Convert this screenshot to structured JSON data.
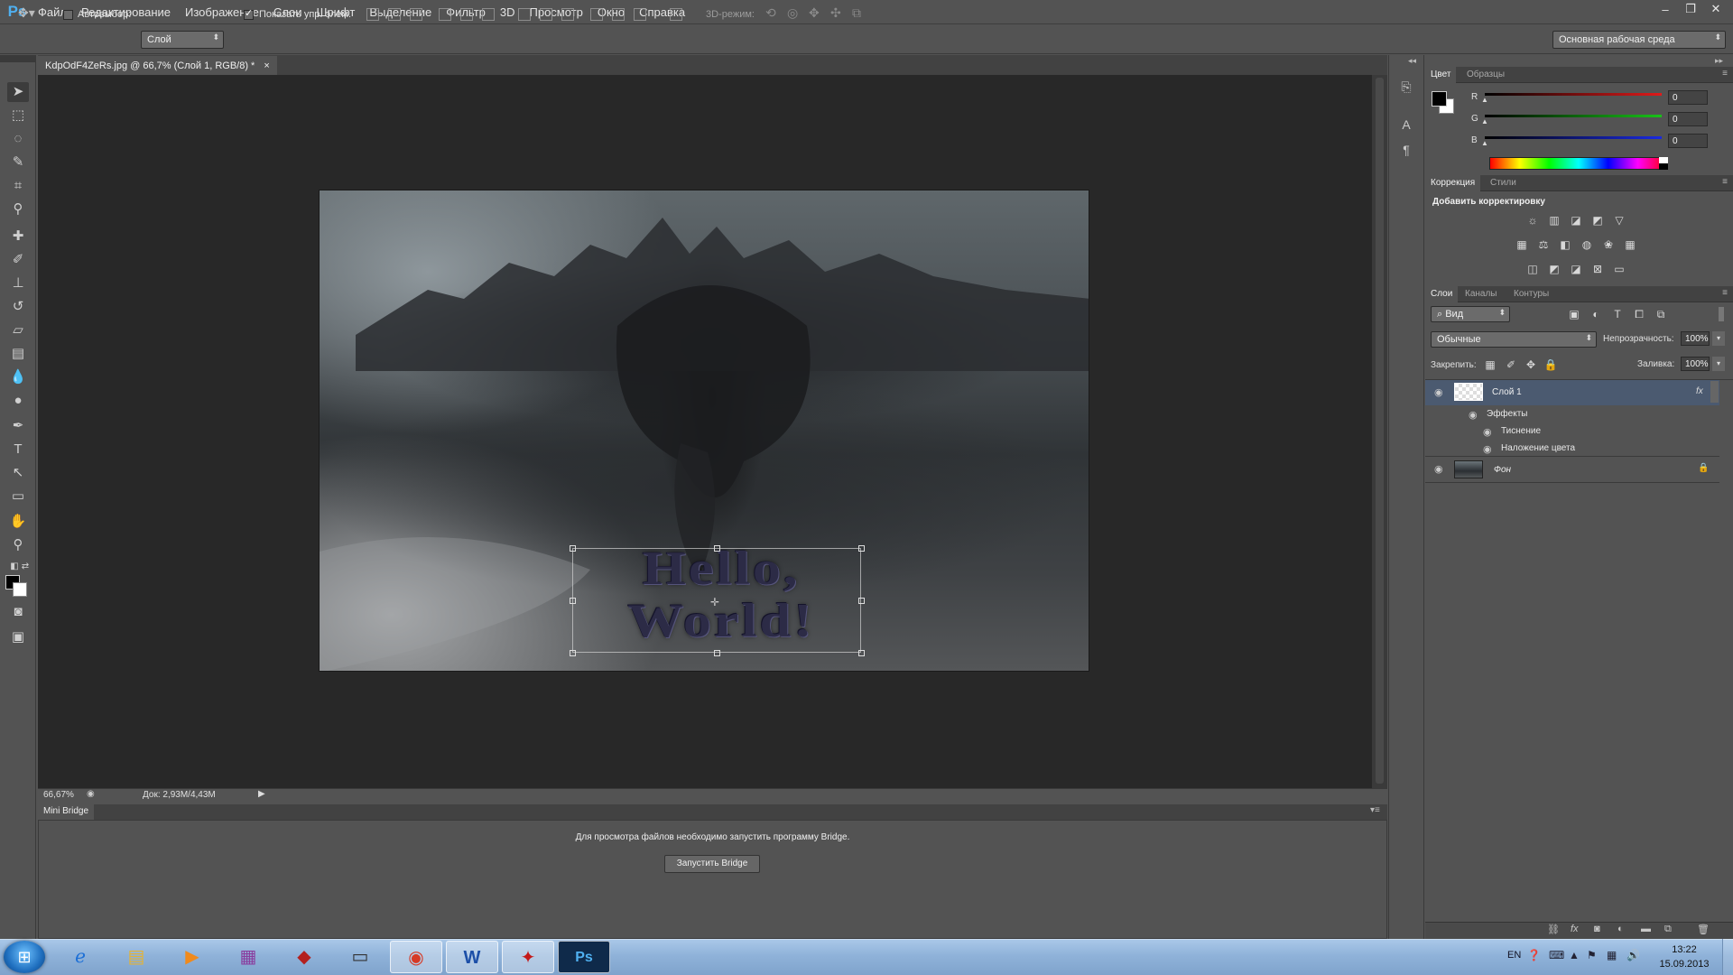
{
  "app": {
    "logo": "Ps"
  },
  "menu": [
    "Файл",
    "Редактирование",
    "Изображение",
    "Слои",
    "Шрифт",
    "Выделение",
    "Фильтр",
    "3D",
    "Просмотр",
    "Окно",
    "Справка"
  ],
  "window_controls": [
    "–",
    "❐",
    "✕"
  ],
  "options": {
    "autoselect_label": "Автовыбор:",
    "autoselect_value": "Слой",
    "show_transform_label": "Показать упр. элем.",
    "mode3d_label": "3D-режим:",
    "workspace": "Основная рабочая среда"
  },
  "document": {
    "tab_title": "KdpOdF4ZeRs.jpg @ 66,7% (Слой 1, RGB/8) *",
    "tab_close": "×",
    "canvas_text_line1": "Hello,",
    "canvas_text_line2": "World!",
    "zoom": "66,67%",
    "doc_size": "Док: 2,93M/4,43M"
  },
  "mini_bridge": {
    "tab": "Mini Bridge",
    "message": "Для просмотра файлов необходимо запустить программу Bridge.",
    "button": "Запустить Bridge"
  },
  "color_panel": {
    "tabs": [
      "Цвет",
      "Образцы"
    ],
    "channels": [
      {
        "label": "R",
        "value": "0",
        "color": "#e01a1a"
      },
      {
        "label": "G",
        "value": "0",
        "color": "#18c218"
      },
      {
        "label": "B",
        "value": "0",
        "color": "#1a2ae0"
      }
    ]
  },
  "adjustments_panel": {
    "tabs": [
      "Коррекция",
      "Стили"
    ],
    "title": "Добавить корректировку"
  },
  "layers_panel": {
    "tabs": [
      "Слои",
      "Каналы",
      "Контуры"
    ],
    "filter": "Вид",
    "blend_mode": "Обычные",
    "opacity_label": "Непрозрачность:",
    "opacity_value": "100%",
    "lock_label": "Закрепить:",
    "fill_label": "Заливка:",
    "fill_value": "100%",
    "layers": [
      {
        "name": "Слой 1",
        "fx": "fx",
        "effects_label": "Эффекты",
        "effects": [
          "Тиснение",
          "Наложение цвета"
        ]
      },
      {
        "name": "Фон"
      }
    ]
  },
  "taskbar": {
    "lang": "EN",
    "time": "13:22",
    "date": "15.09.2013",
    "apps": [
      "internet-explorer",
      "file-explorer",
      "media-player",
      "winrar",
      "dota2",
      "notepad",
      "chrome",
      "word",
      "acrobat",
      "photoshop"
    ]
  },
  "colors": {
    "accent": "#4fb0f0",
    "selected_layer": "#4b5a70"
  }
}
